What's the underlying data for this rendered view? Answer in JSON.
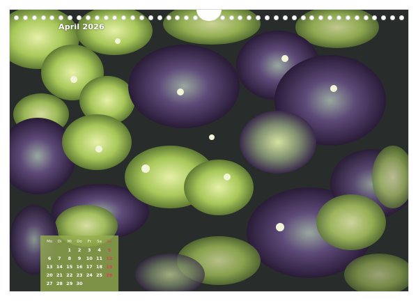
{
  "calendar": {
    "month_title": "April 2026",
    "weekday_headers": [
      "Mo",
      "Di",
      "Mi",
      "Do",
      "Fr",
      "Sa",
      "So"
    ],
    "weeks": [
      [
        "",
        "",
        "1",
        "2",
        "3",
        "4",
        "5"
      ],
      [
        "6",
        "7",
        "8",
        "9",
        "10",
        "11",
        "12"
      ],
      [
        "13",
        "14",
        "15",
        "16",
        "17",
        "18",
        "19"
      ],
      [
        "20",
        "21",
        "22",
        "23",
        "24",
        "25",
        "26"
      ],
      [
        "27",
        "28",
        "29",
        "30",
        "",
        "",
        ""
      ]
    ],
    "accent_sunday_color": "#d94050",
    "panel_color": "#96af50"
  },
  "photo": {
    "subject": "hydrangea-leaves-and-blossoms",
    "palette": [
      "#2a1f3a",
      "#5b3f6e",
      "#8fb84a",
      "#c9dd7a",
      "#1f2a1c"
    ]
  },
  "binding": {
    "ring_count": 44
  }
}
